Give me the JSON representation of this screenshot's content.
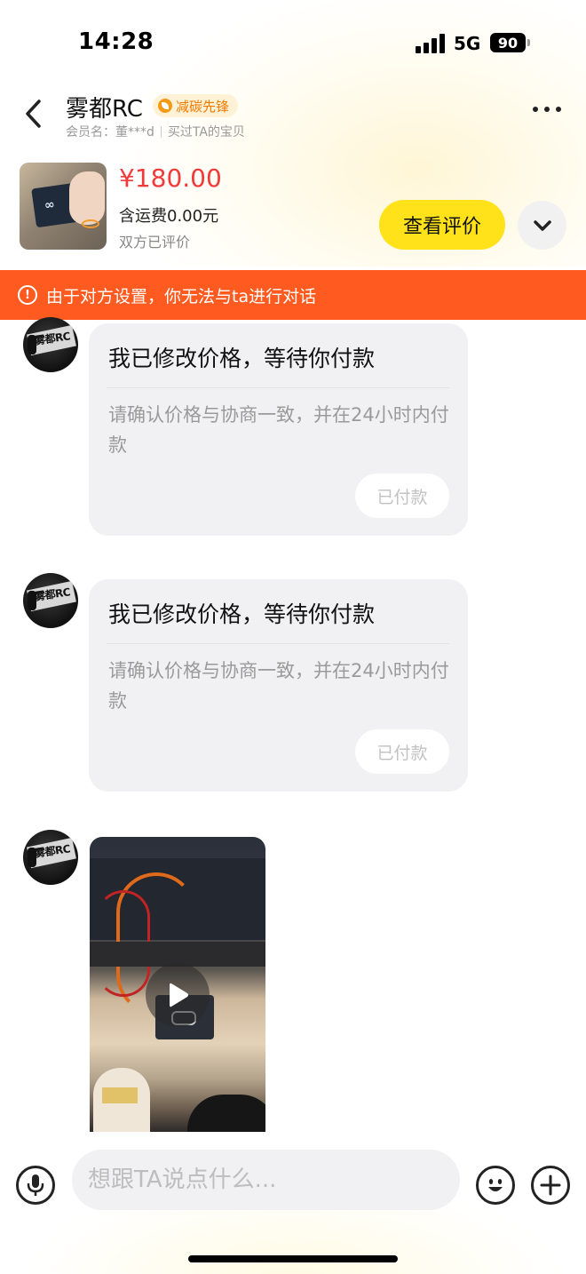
{
  "status_bar": {
    "time": "14:28",
    "network": "5G",
    "battery": "90"
  },
  "header": {
    "shop_name": "雾都RC",
    "badge": "减碳先锋",
    "member_label": "会员名：董***d",
    "bought_label": "买过TA的宝贝"
  },
  "product": {
    "price": "¥180.00",
    "shipping": "含运费0.00元",
    "review_status": "双方已评价",
    "view_review_label": "查看评价"
  },
  "warning": {
    "icon": "!",
    "text": "由于对方设置，你无法与ta进行对话"
  },
  "messages": [
    {
      "avatar_text": "雾都RC",
      "title": "我已修改价格，等待你付款",
      "body": "请确认价格与协商一致，并在24小时内付款",
      "action": "已付款"
    },
    {
      "avatar_text": "雾都RC",
      "title": "我已修改价格，等待你付款",
      "body": "请确认价格与协商一致，并在24小时内付款",
      "action": "已付款"
    },
    {
      "avatar_text": "雾都RC",
      "type": "video"
    }
  ],
  "input": {
    "placeholder": "想跟TA说点什么..."
  },
  "colors": {
    "accent_yellow": "#ffe21a",
    "price_red": "#f23a3a",
    "warning_orange": "#ff5a1f",
    "badge_orange": "#f07a00"
  }
}
